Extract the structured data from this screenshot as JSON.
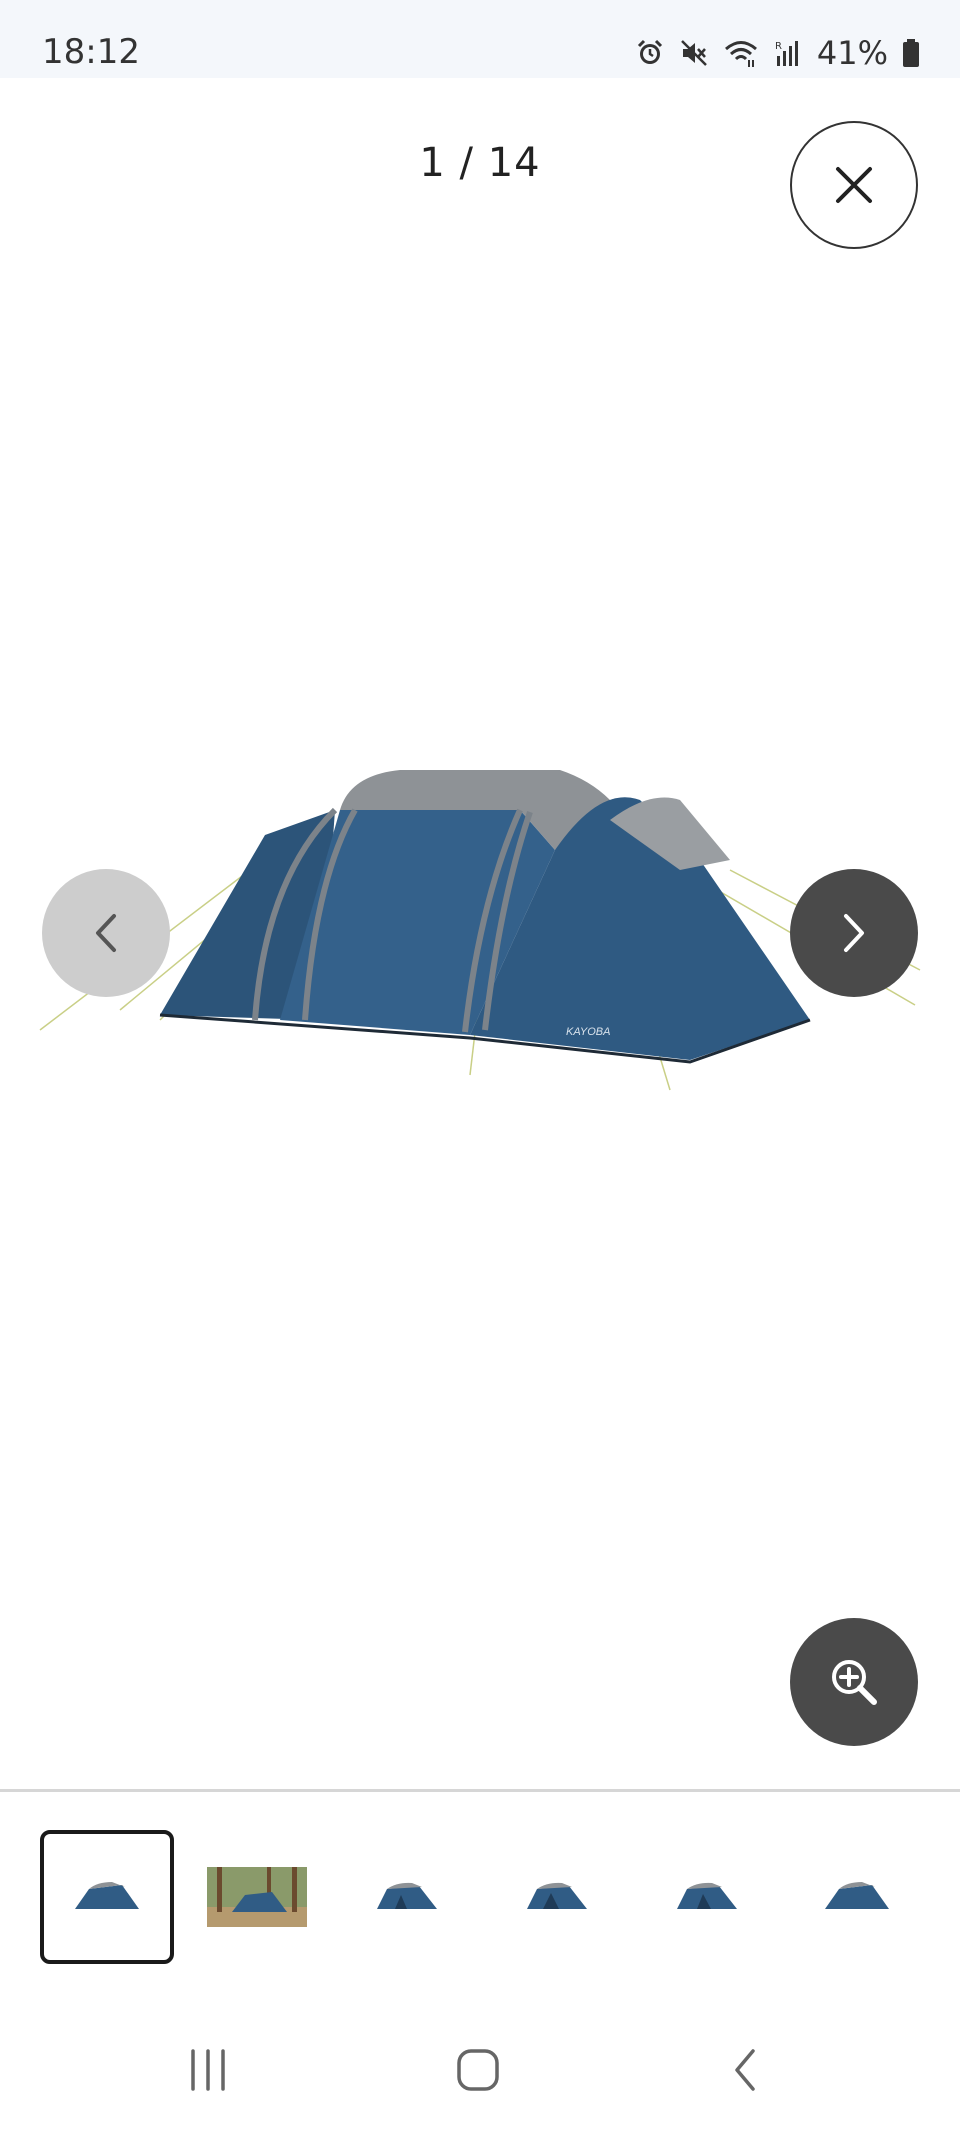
{
  "status_bar": {
    "time": "18:12",
    "battery_percent": "41%",
    "icons": [
      "alarm-icon",
      "mute-icon",
      "wifi-icon",
      "signal-icon",
      "battery-icon"
    ]
  },
  "gallery": {
    "counter": "1 / 14",
    "current_index": 1,
    "total": 14,
    "main_image_brand_text": "KAYOBA"
  },
  "thumbnails": [
    {
      "type": "tent-studio",
      "selected": true
    },
    {
      "type": "tent-outdoor",
      "selected": false
    },
    {
      "type": "tent-studio",
      "selected": false
    },
    {
      "type": "tent-studio",
      "selected": false
    },
    {
      "type": "tent-studio",
      "selected": false
    },
    {
      "type": "tent-studio",
      "selected": false
    }
  ],
  "colors": {
    "tent_body": "#2f5a82",
    "tent_roof": "#8f9397",
    "nav_dark": "#4a4a4a",
    "nav_light": "#cdcdcd"
  },
  "nav_bar": {
    "icons": [
      "recent-apps-icon",
      "home-icon",
      "back-icon"
    ]
  }
}
